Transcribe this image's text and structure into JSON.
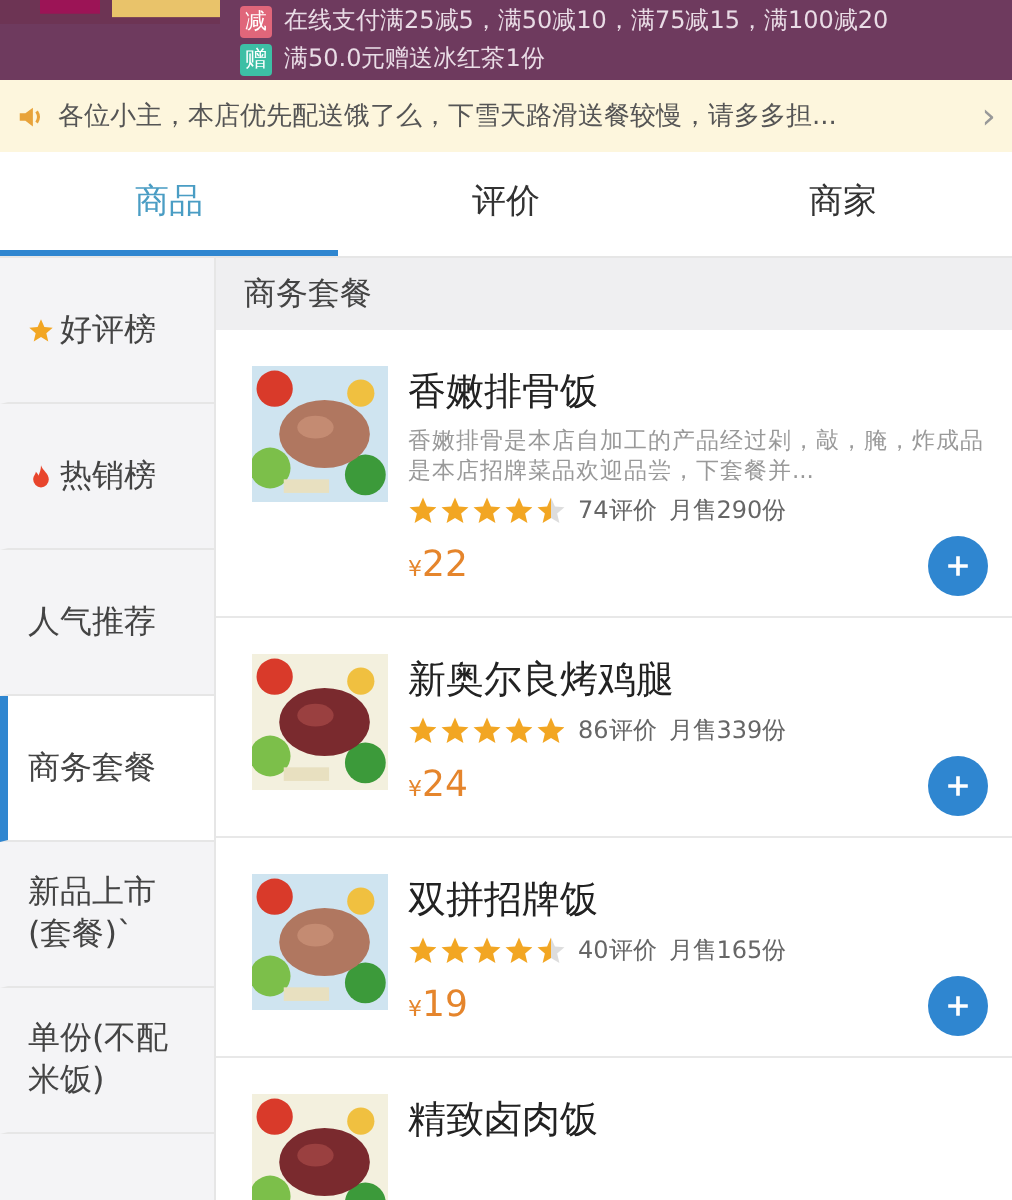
{
  "promos": [
    {
      "kind": "discount",
      "badge": "减",
      "text": "在线支付满25减5，满50减10，满75减15，满100减20"
    },
    {
      "kind": "gift",
      "badge": "赠",
      "text": "满50.0元赠送冰红茶1份"
    }
  ],
  "notice": {
    "text": "各位小主，本店优先配送饿了么，下雪天路滑送餐较慢，请多多担...",
    "arrow": "›"
  },
  "tabs": [
    {
      "label": "商品",
      "selected": true
    },
    {
      "label": "评价",
      "selected": false
    },
    {
      "label": "商家",
      "selected": false
    }
  ],
  "sidebar": {
    "items": [
      {
        "label": "好评榜",
        "kind": "star",
        "selected": false
      },
      {
        "label": "热销榜",
        "kind": "fire",
        "selected": false
      },
      {
        "label": "人气推荐",
        "kind": "plain",
        "selected": false
      },
      {
        "label": "商务套餐",
        "kind": "plain",
        "selected": true
      },
      {
        "label": "新品上市(套餐)`",
        "kind": "plain",
        "selected": false
      },
      {
        "label": "单份(不配米饭)",
        "kind": "plain",
        "selected": false
      }
    ]
  },
  "section": {
    "title": "商务套餐"
  },
  "products": [
    {
      "name": "香嫩排骨饭",
      "description": "香嫩排骨是本店自加工的产品经过剁，敲，腌，炸成品是本店招牌菜品欢迎品尝，下套餐并...",
      "stars": 4.5,
      "reviews": "74评价",
      "sales": "月售290份",
      "currency": "¥",
      "price": "22"
    },
    {
      "name": "新奥尔良烤鸡腿",
      "stars": 5,
      "reviews": "86评价",
      "sales": "月售339份",
      "currency": "¥",
      "price": "24"
    },
    {
      "name": "双拼招牌饭",
      "stars": 4.5,
      "reviews": "40评价",
      "sales": "月售165份",
      "currency": "¥",
      "price": "19"
    },
    {
      "name": "精致卤肉饭"
    }
  ]
}
